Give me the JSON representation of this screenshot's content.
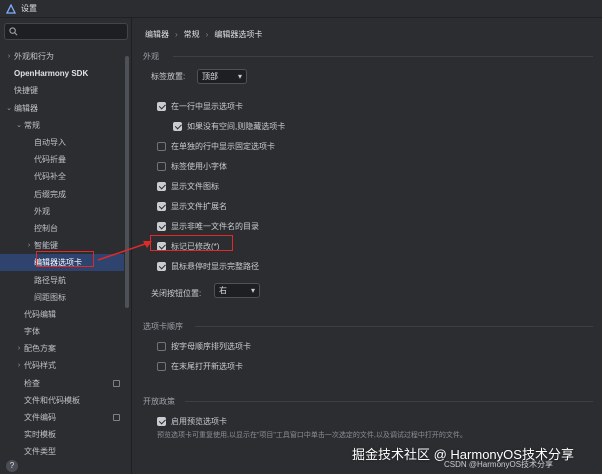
{
  "window": {
    "title": "设置"
  },
  "sidebar": {
    "search_placeholder": "",
    "items": [
      {
        "label": "外观和行为",
        "arrow": "›",
        "bold": false,
        "selected": false,
        "modified": false
      },
      {
        "label": "OpenHarmony SDK",
        "arrow": "",
        "bold": true,
        "selected": false,
        "modified": false
      },
      {
        "label": "快捷键",
        "arrow": "",
        "bold": false,
        "selected": false,
        "modified": false
      },
      {
        "label": "编辑器",
        "arrow": "⌄",
        "bold": false,
        "selected": false,
        "modified": false
      },
      {
        "label": "常规",
        "arrow": "⌄",
        "bold": false,
        "selected": false,
        "modified": false
      },
      {
        "label": "自动导入",
        "arrow": "",
        "bold": false,
        "selected": false,
        "modified": false
      },
      {
        "label": "代码折叠",
        "arrow": "",
        "bold": false,
        "selected": false,
        "modified": false
      },
      {
        "label": "代码补全",
        "arrow": "",
        "bold": false,
        "selected": false,
        "modified": false
      },
      {
        "label": "后缀完成",
        "arrow": "",
        "bold": false,
        "selected": false,
        "modified": false
      },
      {
        "label": "外观",
        "arrow": "",
        "bold": false,
        "selected": false,
        "modified": false
      },
      {
        "label": "控制台",
        "arrow": "",
        "bold": false,
        "selected": false,
        "modified": false
      },
      {
        "label": "智能键",
        "arrow": "›",
        "bold": false,
        "selected": false,
        "modified": false
      },
      {
        "label": "编辑器选项卡",
        "arrow": "",
        "bold": false,
        "selected": true,
        "modified": false
      },
      {
        "label": "路径导航",
        "arrow": "",
        "bold": false,
        "selected": false,
        "modified": false
      },
      {
        "label": "间距图标",
        "arrow": "",
        "bold": false,
        "selected": false,
        "modified": false
      },
      {
        "label": "代码编辑",
        "arrow": "",
        "bold": false,
        "selected": false,
        "modified": false
      },
      {
        "label": "字体",
        "arrow": "",
        "bold": false,
        "selected": false,
        "modified": false
      },
      {
        "label": "配色方案",
        "arrow": "›",
        "bold": false,
        "selected": false,
        "modified": false
      },
      {
        "label": "代码样式",
        "arrow": "›",
        "bold": false,
        "selected": false,
        "modified": false
      },
      {
        "label": "检查",
        "arrow": "",
        "bold": false,
        "selected": false,
        "modified": true
      },
      {
        "label": "文件和代码模板",
        "arrow": "",
        "bold": false,
        "selected": false,
        "modified": false
      },
      {
        "label": "文件编码",
        "arrow": "",
        "bold": false,
        "selected": false,
        "modified": true
      },
      {
        "label": "实时模板",
        "arrow": "",
        "bold": false,
        "selected": false,
        "modified": false
      },
      {
        "label": "文件类型",
        "arrow": "",
        "bold": false,
        "selected": false,
        "modified": false
      }
    ],
    "help_label": "?"
  },
  "breadcrumb": {
    "items": [
      "编辑器",
      "常规",
      "编辑器选项卡"
    ],
    "separator": "›"
  },
  "appearance": {
    "section_title": "外观",
    "tab_placement_label": "标签放置:",
    "tab_placement_value": "顶部",
    "options": [
      {
        "label": "在一行中显示选项卡",
        "checked": true
      },
      {
        "label": "如果没有空间,则隐藏选项卡",
        "checked": true
      },
      {
        "label": "在单独的行中显示固定选项卡",
        "checked": false
      },
      {
        "label": "标签使用小字体",
        "checked": false
      },
      {
        "label": "显示文件图标",
        "checked": true
      },
      {
        "label": "显示文件扩展名",
        "checked": true
      },
      {
        "label": "显示非唯一文件名的目录",
        "checked": true
      },
      {
        "label": "标记已修改(*)",
        "checked": true
      },
      {
        "label": "鼠标悬停时显示完整路径",
        "checked": true
      }
    ],
    "close_button_label": "关闭按钮位置:",
    "close_button_value": "右"
  },
  "tab_order": {
    "section_title": "选项卡顺序",
    "options": [
      {
        "label": "按字母顺序排列选项卡",
        "checked": false
      },
      {
        "label": "在末尾打开新选项卡",
        "checked": false
      }
    ]
  },
  "opening_policy": {
    "section_title": "开放政策",
    "options": [
      {
        "label": "启用预览选项卡",
        "checked": true
      }
    ],
    "hint": "预览选项卡可重复使用,以显示在\"项目\"工具窗口中单击一次选定的文件,以及调试过程中打开的文件。"
  },
  "watermark": {
    "text": "掘金技术社区 @ HarmonyOS技术分享",
    "credit": "CSDN @HarmonyOS技术分享"
  },
  "colors": {
    "accent": "#2e436e",
    "annotation": "#e02a2a",
    "background": "#2b2d30"
  }
}
